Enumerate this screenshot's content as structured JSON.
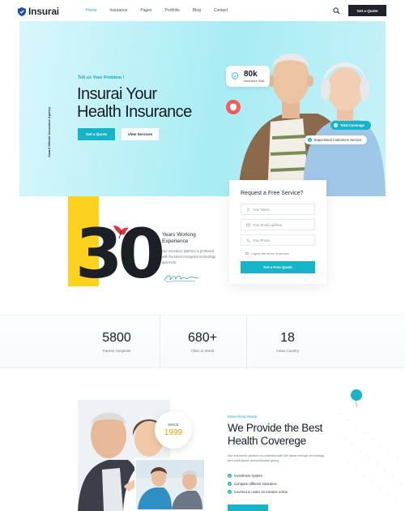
{
  "header": {
    "logo_text": "Insurai",
    "nav": [
      "Home",
      "Insurance",
      "Pages",
      "Portfolio",
      "Blog",
      "Contact"
    ],
    "quote_button": "Get a Quote"
  },
  "hero": {
    "vertical_tag": "Award Winner Insurance Agency",
    "kicker": "Tell us Your Problem !",
    "title_line1": "Insurai Your",
    "title_line2": "Health Insurance",
    "primary_button": "Get a Quote",
    "secondary_button": "View Services",
    "stat_number": "80k",
    "stat_label": "Insurance Sold",
    "pill_total": "Total Coverage",
    "pill_experience": "Expectional Customers Service"
  },
  "years": {
    "number": "30",
    "title": "Years Working Experience",
    "description": "Our insurance platform is protected with the latest encryption technology and multi-"
  },
  "form": {
    "title": "Request a Free Service?",
    "name_placeholder": "Your Name",
    "email_placeholder": "Your Email Address",
    "phone_placeholder": "Your Phone",
    "terms": "I agree the terms of service",
    "submit": "Get a Free Quote"
  },
  "stats": [
    {
      "value": "5800",
      "label": "Partner Hospitals"
    },
    {
      "value": "680+",
      "label": "Clinic in World"
    },
    {
      "value": "18",
      "label": "Asian Country"
    }
  ],
  "about": {
    "since_label": "SINCE",
    "since_year": "1999",
    "kicker": "Know About Insurai",
    "title": "We Provide the Best Health Coverege",
    "description": "Our insurance platform is protected with the latest encrypt technology and multi-factor authentication giving",
    "items": [
      "Investment system",
      "Compare different insurance",
      "Covered in under 10 minutes online"
    ]
  },
  "colors": {
    "accent": "#17b3c8",
    "dark": "#20232b",
    "yellow": "#fcd21d",
    "red": "#ff5a5a"
  }
}
